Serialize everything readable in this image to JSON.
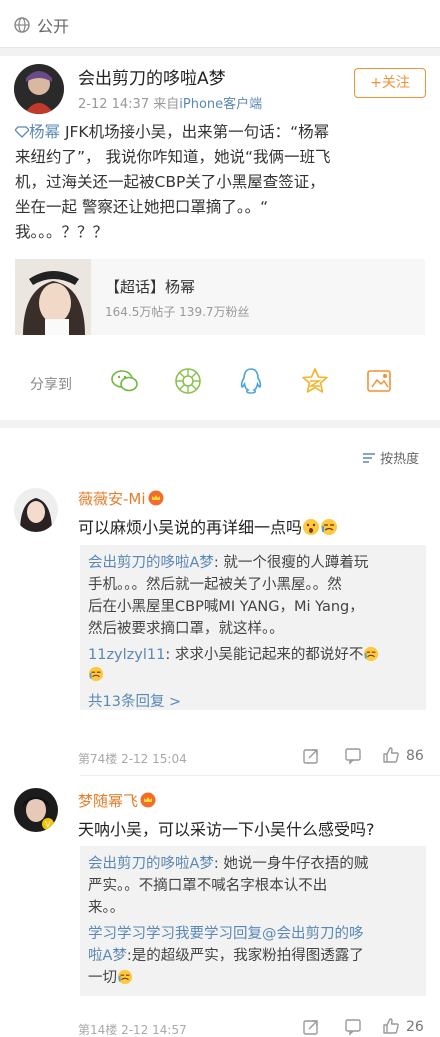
{
  "header": {
    "visibility": "公开",
    "icon": "globe-icon"
  },
  "post": {
    "author": "会出剪刀的哆啦A梦",
    "time": "2-12 14:37",
    "source_prefix": "来自",
    "source": "iPhone客户端",
    "follow_label": "+关注",
    "mention": "杨幂",
    "text_line1_rest": " JFK机场接小吴，出来第一句话：“杨幂",
    "text_line2": "来纽约了”， 我说你咋知道，她说“我俩一班飞",
    "text_line3": "机，过海关还一起被CBP关了小黑屋查签证，",
    "text_line4": "坐在一起 警察还让她把口罩摘了。。“",
    "text_line5": "我。。。？？？",
    "topic": {
      "title": "【超话】杨幂",
      "stats": "164.5万帖子 139.7万粉丝"
    },
    "share_label": "分享到",
    "share_icons": [
      "wechat-icon",
      "moments-icon",
      "qq-icon",
      "qzone-icon",
      "weibo-share-icon"
    ]
  },
  "comments": {
    "sort_label": "按热度",
    "items": [
      {
        "name": "薇薇安-Mi",
        "text": "可以麻烦小吴说的再详细一点吗",
        "reply1_user": "会出剪刀的哆啦A梦",
        "reply1_line1": ": 就一个很瘦的人蹲着玩",
        "reply1_line2": "手机。。。然后就一起被关了小黑屋。。然",
        "reply1_line3": "后在小黑屋里CBP喊MI YANG，Mi Yang，",
        "reply1_line4": "然后被要求摘口罩，就这样。。",
        "reply2_user": "11zylzyl11",
        "reply2_text": ": 求求小吴能记起来的都说好不",
        "more": "共13条回复 >",
        "floor": "第74楼  2-12 15:04",
        "likes": "86"
      },
      {
        "name": "梦随幂飞",
        "text": "天呐小吴，可以采访一下小吴什么感受吗?",
        "reply1_user": "会出剪刀的哆啦A梦",
        "reply1_line1": ": 她说一身牛仔衣捂的贼",
        "reply1_line2": "严实。。不摘口罩不喊名字根本认不出",
        "reply1_line3": "来。。",
        "reply2_user_line1": "学习学习学习我要学习回复@会出剪刀的哆",
        "reply2_user_line2": "啦A梦",
        "reply2_line2_rest": ":是的超级严实，我家粉拍得图透露了",
        "reply2_line3": "一切",
        "floor": "第14楼  2-12 14:57",
        "likes": "26"
      }
    ]
  },
  "colors": {
    "link": "#5a88b6",
    "accent": "#f29135",
    "username": "#e77d2a"
  }
}
